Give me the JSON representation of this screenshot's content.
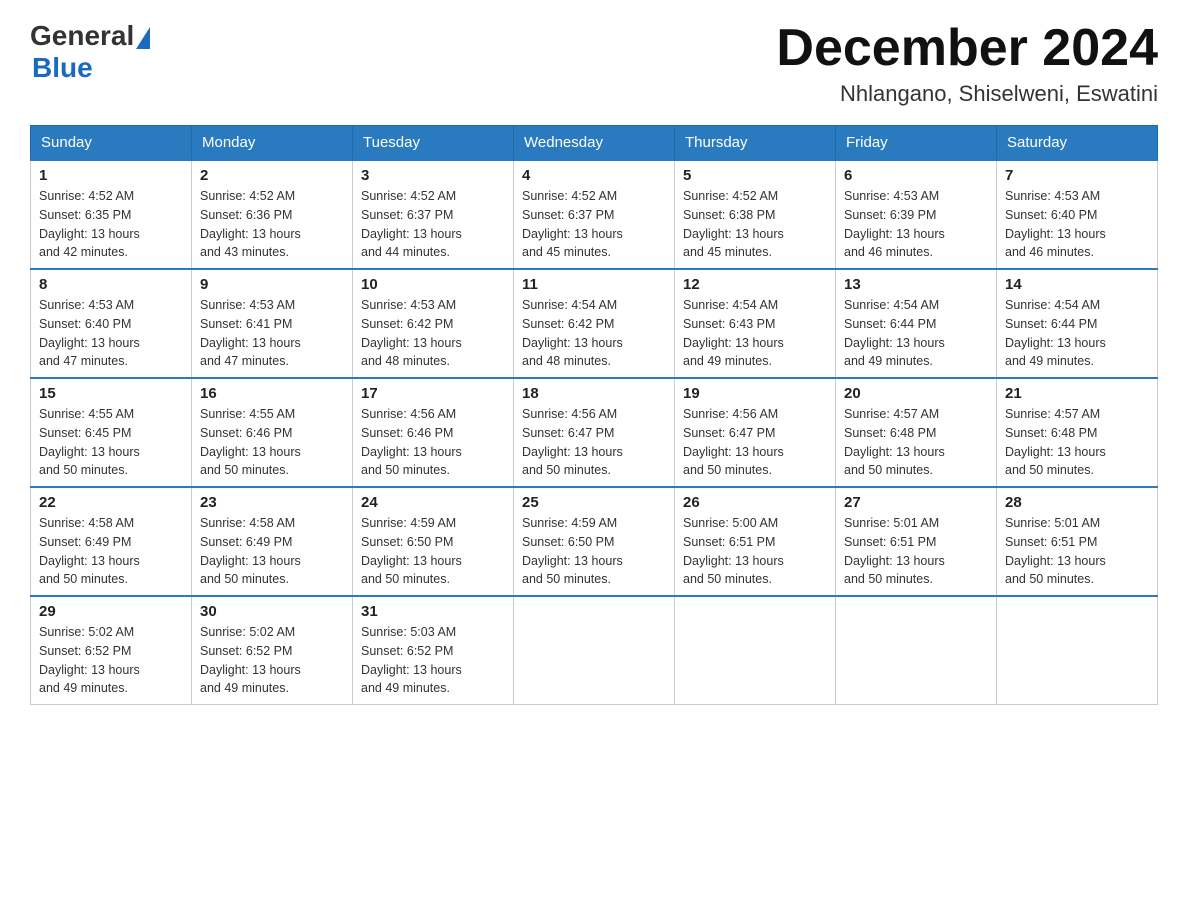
{
  "header": {
    "logo_general": "General",
    "logo_blue": "Blue",
    "month_title": "December 2024",
    "location": "Nhlangano, Shiselweni, Eswatini"
  },
  "weekdays": [
    "Sunday",
    "Monday",
    "Tuesday",
    "Wednesday",
    "Thursday",
    "Friday",
    "Saturday"
  ],
  "weeks": [
    [
      {
        "day": "1",
        "sunrise": "4:52 AM",
        "sunset": "6:35 PM",
        "daylight": "13 hours and 42 minutes."
      },
      {
        "day": "2",
        "sunrise": "4:52 AM",
        "sunset": "6:36 PM",
        "daylight": "13 hours and 43 minutes."
      },
      {
        "day": "3",
        "sunrise": "4:52 AM",
        "sunset": "6:37 PM",
        "daylight": "13 hours and 44 minutes."
      },
      {
        "day": "4",
        "sunrise": "4:52 AM",
        "sunset": "6:37 PM",
        "daylight": "13 hours and 45 minutes."
      },
      {
        "day": "5",
        "sunrise": "4:52 AM",
        "sunset": "6:38 PM",
        "daylight": "13 hours and 45 minutes."
      },
      {
        "day": "6",
        "sunrise": "4:53 AM",
        "sunset": "6:39 PM",
        "daylight": "13 hours and 46 minutes."
      },
      {
        "day": "7",
        "sunrise": "4:53 AM",
        "sunset": "6:40 PM",
        "daylight": "13 hours and 46 minutes."
      }
    ],
    [
      {
        "day": "8",
        "sunrise": "4:53 AM",
        "sunset": "6:40 PM",
        "daylight": "13 hours and 47 minutes."
      },
      {
        "day": "9",
        "sunrise": "4:53 AM",
        "sunset": "6:41 PM",
        "daylight": "13 hours and 47 minutes."
      },
      {
        "day": "10",
        "sunrise": "4:53 AM",
        "sunset": "6:42 PM",
        "daylight": "13 hours and 48 minutes."
      },
      {
        "day": "11",
        "sunrise": "4:54 AM",
        "sunset": "6:42 PM",
        "daylight": "13 hours and 48 minutes."
      },
      {
        "day": "12",
        "sunrise": "4:54 AM",
        "sunset": "6:43 PM",
        "daylight": "13 hours and 49 minutes."
      },
      {
        "day": "13",
        "sunrise": "4:54 AM",
        "sunset": "6:44 PM",
        "daylight": "13 hours and 49 minutes."
      },
      {
        "day": "14",
        "sunrise": "4:54 AM",
        "sunset": "6:44 PM",
        "daylight": "13 hours and 49 minutes."
      }
    ],
    [
      {
        "day": "15",
        "sunrise": "4:55 AM",
        "sunset": "6:45 PM",
        "daylight": "13 hours and 50 minutes."
      },
      {
        "day": "16",
        "sunrise": "4:55 AM",
        "sunset": "6:46 PM",
        "daylight": "13 hours and 50 minutes."
      },
      {
        "day": "17",
        "sunrise": "4:56 AM",
        "sunset": "6:46 PM",
        "daylight": "13 hours and 50 minutes."
      },
      {
        "day": "18",
        "sunrise": "4:56 AM",
        "sunset": "6:47 PM",
        "daylight": "13 hours and 50 minutes."
      },
      {
        "day": "19",
        "sunrise": "4:56 AM",
        "sunset": "6:47 PM",
        "daylight": "13 hours and 50 minutes."
      },
      {
        "day": "20",
        "sunrise": "4:57 AM",
        "sunset": "6:48 PM",
        "daylight": "13 hours and 50 minutes."
      },
      {
        "day": "21",
        "sunrise": "4:57 AM",
        "sunset": "6:48 PM",
        "daylight": "13 hours and 50 minutes."
      }
    ],
    [
      {
        "day": "22",
        "sunrise": "4:58 AM",
        "sunset": "6:49 PM",
        "daylight": "13 hours and 50 minutes."
      },
      {
        "day": "23",
        "sunrise": "4:58 AM",
        "sunset": "6:49 PM",
        "daylight": "13 hours and 50 minutes."
      },
      {
        "day": "24",
        "sunrise": "4:59 AM",
        "sunset": "6:50 PM",
        "daylight": "13 hours and 50 minutes."
      },
      {
        "day": "25",
        "sunrise": "4:59 AM",
        "sunset": "6:50 PM",
        "daylight": "13 hours and 50 minutes."
      },
      {
        "day": "26",
        "sunrise": "5:00 AM",
        "sunset": "6:51 PM",
        "daylight": "13 hours and 50 minutes."
      },
      {
        "day": "27",
        "sunrise": "5:01 AM",
        "sunset": "6:51 PM",
        "daylight": "13 hours and 50 minutes."
      },
      {
        "day": "28",
        "sunrise": "5:01 AM",
        "sunset": "6:51 PM",
        "daylight": "13 hours and 50 minutes."
      }
    ],
    [
      {
        "day": "29",
        "sunrise": "5:02 AM",
        "sunset": "6:52 PM",
        "daylight": "13 hours and 49 minutes."
      },
      {
        "day": "30",
        "sunrise": "5:02 AM",
        "sunset": "6:52 PM",
        "daylight": "13 hours and 49 minutes."
      },
      {
        "day": "31",
        "sunrise": "5:03 AM",
        "sunset": "6:52 PM",
        "daylight": "13 hours and 49 minutes."
      },
      null,
      null,
      null,
      null
    ]
  ],
  "labels": {
    "sunrise_prefix": "Sunrise: ",
    "sunset_prefix": "Sunset: ",
    "daylight_prefix": "Daylight: "
  }
}
